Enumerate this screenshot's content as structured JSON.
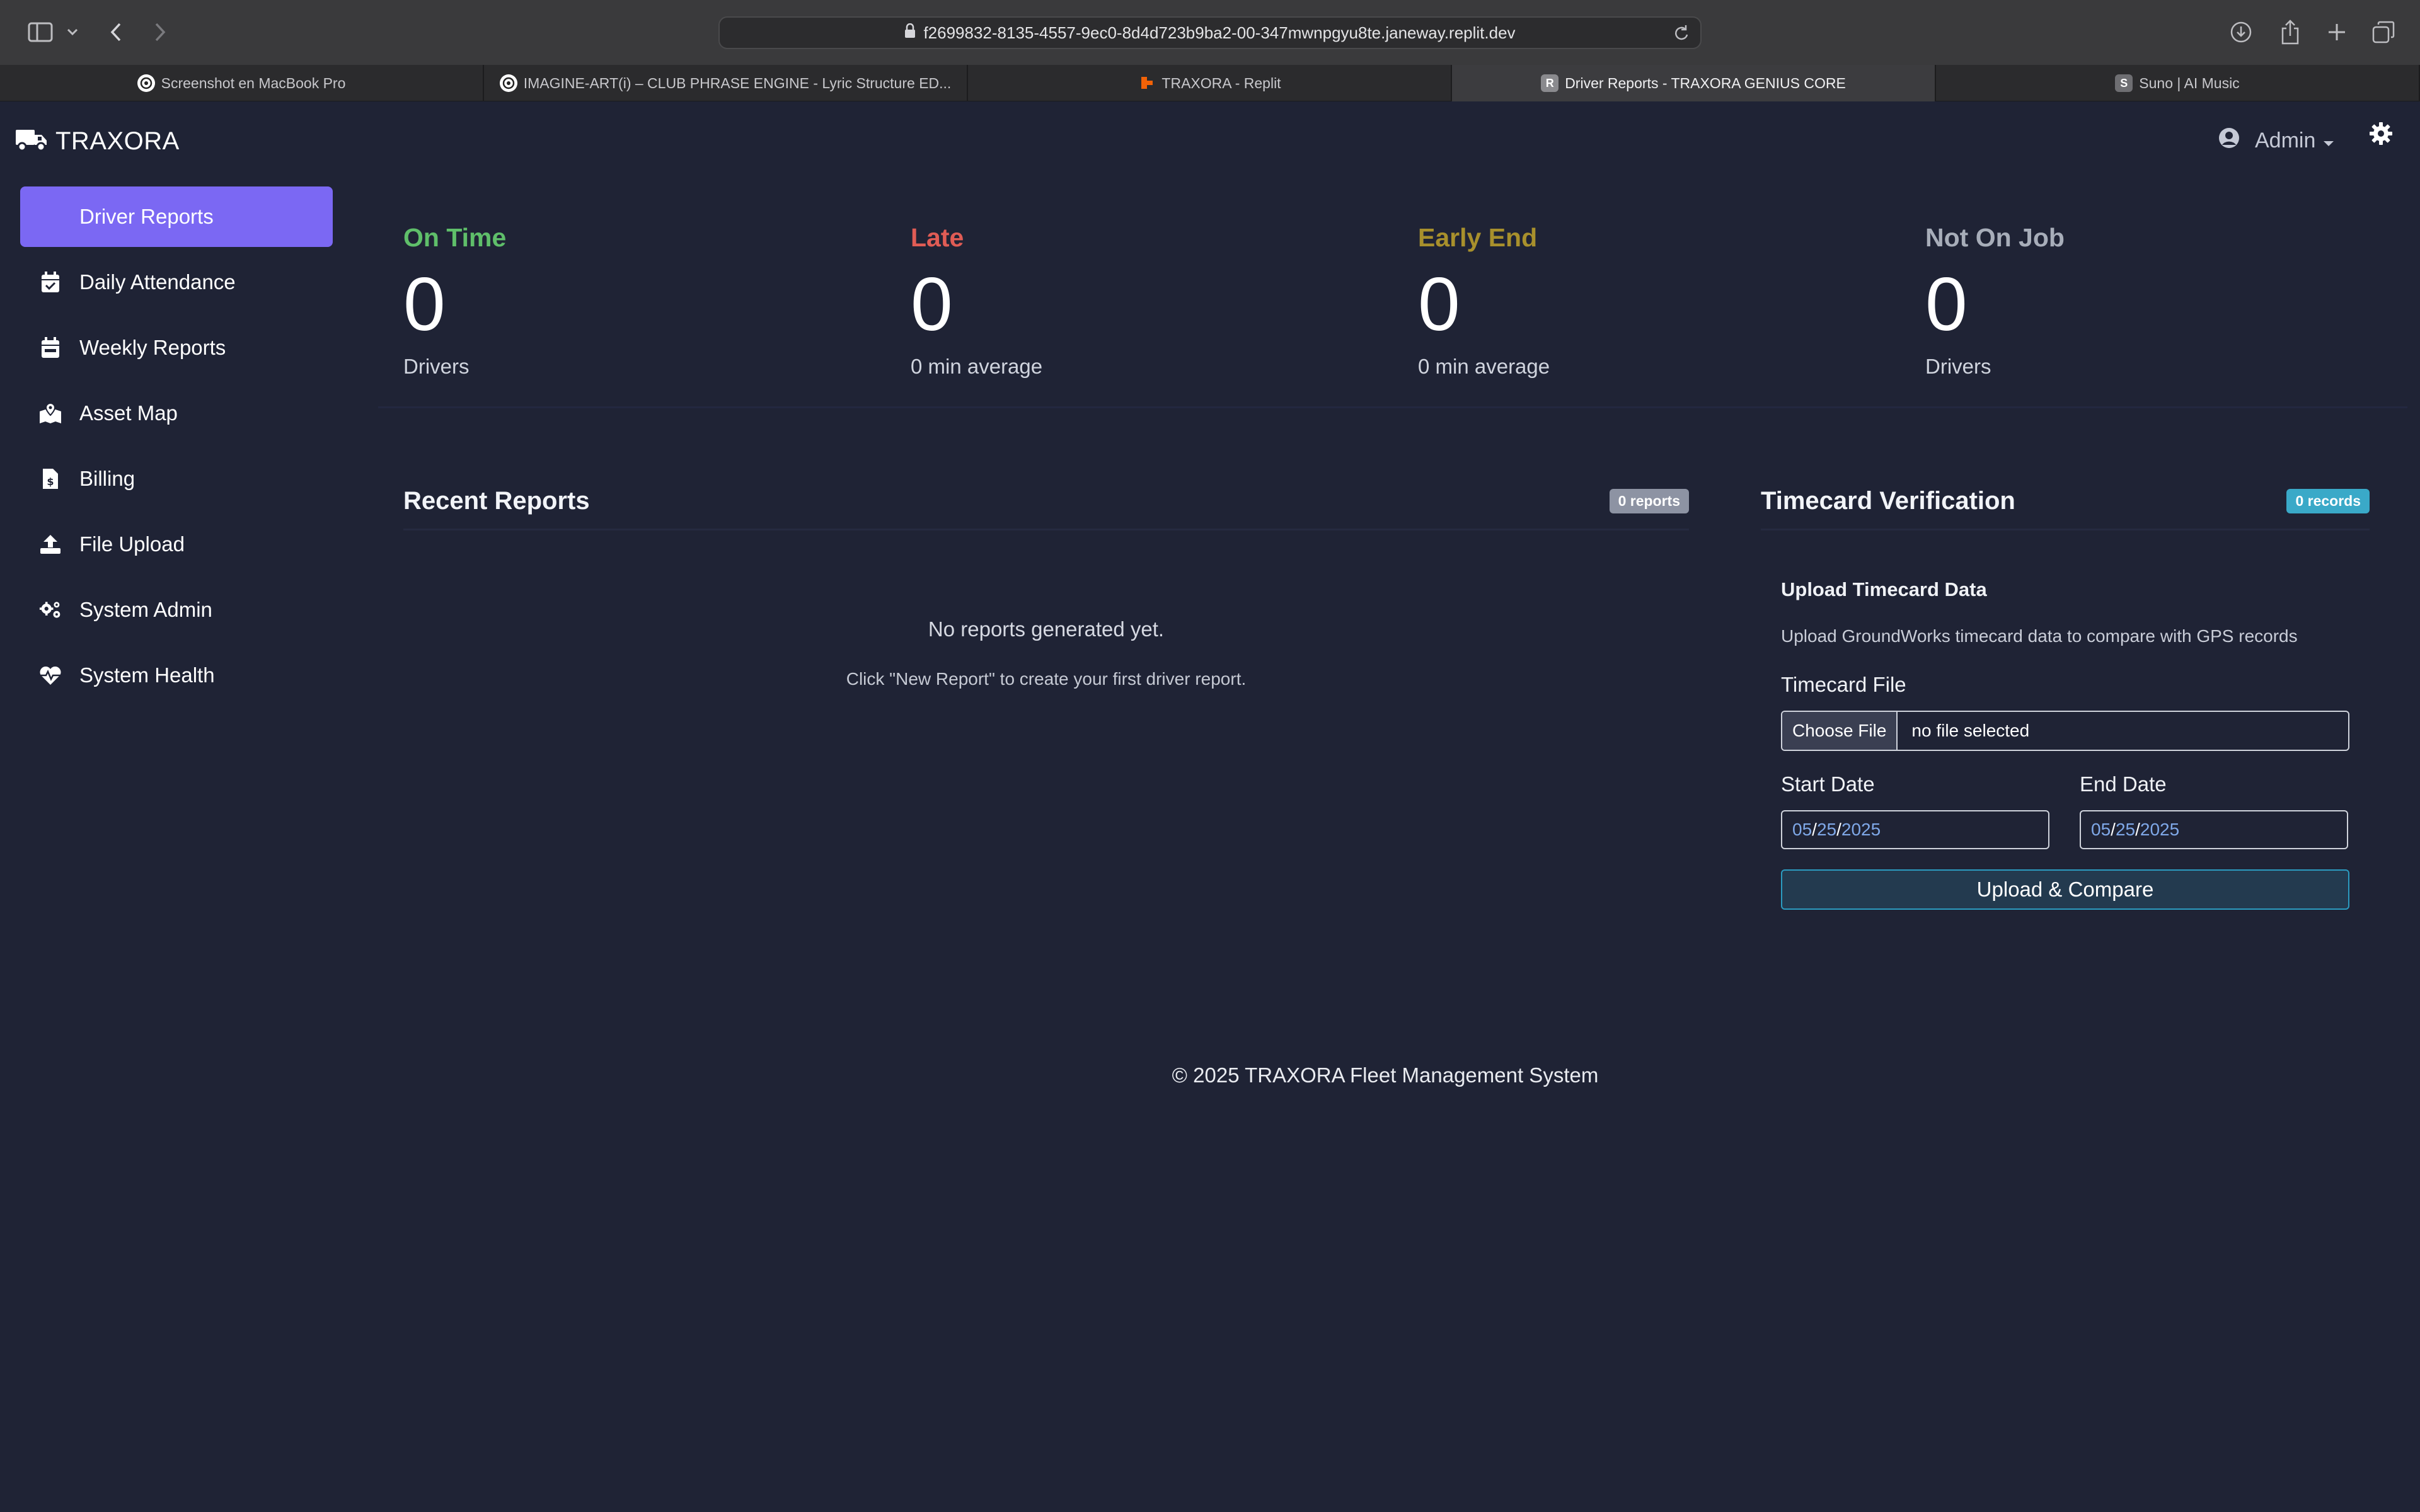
{
  "browser": {
    "url": "f2699832-8135-4557-9ec0-8d4d723b9ba2-00-347mwnpgyu8te.janeway.replit.dev",
    "tabs": [
      {
        "label": "Screenshot en MacBook Pro",
        "icon": "openai-icon",
        "active": false
      },
      {
        "label": "IMAGINE-ART(i) – CLUB PHRASE ENGINE - Lyric Structure ED...",
        "icon": "openai-icon",
        "active": false
      },
      {
        "label": "TRAXORA - Replit",
        "icon": "replit-icon",
        "active": false
      },
      {
        "label": "Driver Reports - TRAXORA GENIUS CORE",
        "icon": "letter-r-icon",
        "favicon_letter": "R",
        "active": true
      },
      {
        "label": "Suno | AI Music",
        "icon": "letter-s-icon",
        "favicon_letter": "S",
        "active": false
      }
    ]
  },
  "app": {
    "brand": "TRAXORA",
    "user_menu": "Admin"
  },
  "sidebar": {
    "items": [
      {
        "label": "Driver Reports",
        "icon": "none",
        "active": true
      },
      {
        "label": "Daily Attendance",
        "icon": "calendar-check-icon"
      },
      {
        "label": "Weekly Reports",
        "icon": "calendar-week-icon"
      },
      {
        "label": "Asset Map",
        "icon": "map-marked-icon"
      },
      {
        "label": "Billing",
        "icon": "invoice-dollar-icon"
      },
      {
        "label": "File Upload",
        "icon": "upload-icon"
      },
      {
        "label": "System Admin",
        "icon": "cogs-icon"
      },
      {
        "label": "System Health",
        "icon": "heartbeat-icon"
      }
    ]
  },
  "stats": [
    {
      "title": "On Time",
      "value": "0",
      "sub": "Drivers",
      "color": "#5fbf6a"
    },
    {
      "title": "Late",
      "value": "0",
      "sub": "0 min average",
      "color": "#e05c55"
    },
    {
      "title": "Early End",
      "value": "0",
      "sub": "0 min average",
      "color": "#a8902c"
    },
    {
      "title": "Not On Job",
      "value": "0",
      "sub": "Drivers",
      "color": "#a7adb9"
    }
  ],
  "recent_reports": {
    "title": "Recent Reports",
    "badge": "0 reports",
    "badge_color": "#8d93a3",
    "empty_title": "No reports generated yet.",
    "empty_hint": "Click \"New Report\" to create your first driver report."
  },
  "timecard": {
    "title": "Timecard Verification",
    "badge": "0 records",
    "badge_color": "#3aa9c8",
    "section_title": "Upload Timecard Data",
    "description": "Upload GroundWorks timecard data to compare with GPS records",
    "file_label": "Timecard File",
    "file_button": "Choose File",
    "file_status": "no file selected",
    "start_label": "Start Date",
    "end_label": "End Date",
    "start_date": {
      "mm": "05",
      "dd": "25",
      "yyyy": "2025"
    },
    "end_date": {
      "mm": "05",
      "dd": "25",
      "yyyy": "2025"
    },
    "submit": "Upload & Compare"
  },
  "footer": "© 2025 TRAXORA Fleet Management System"
}
